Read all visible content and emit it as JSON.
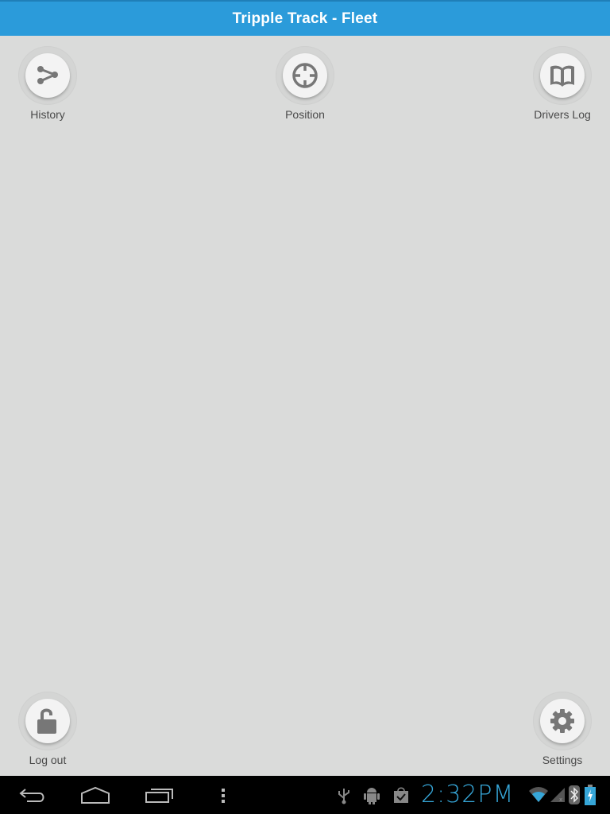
{
  "app": {
    "title": "Tripple Track - Fleet"
  },
  "menu": {
    "history": {
      "label": "History",
      "icon": "history-share-icon"
    },
    "position": {
      "label": "Position",
      "icon": "crosshair-icon"
    },
    "drivers_log": {
      "label": "Drivers Log",
      "icon": "book-icon"
    },
    "logout": {
      "label": "Log out",
      "icon": "unlock-icon"
    },
    "settings": {
      "label": "Settings",
      "icon": "gear-icon"
    }
  },
  "system_bar": {
    "clock": "2:32PM",
    "nav": [
      "back",
      "home",
      "recent-apps",
      "menu"
    ],
    "notifications": [
      "usb-icon",
      "android-debug-icon",
      "store-download-icon"
    ],
    "status_icons": [
      "wifi-icon",
      "cell-signal-icon",
      "bluetooth-icon",
      "battery-charging-icon"
    ],
    "accent": "#36a6d8"
  },
  "colors": {
    "titlebar": "#2b9bda",
    "background": "#dadbda"
  }
}
